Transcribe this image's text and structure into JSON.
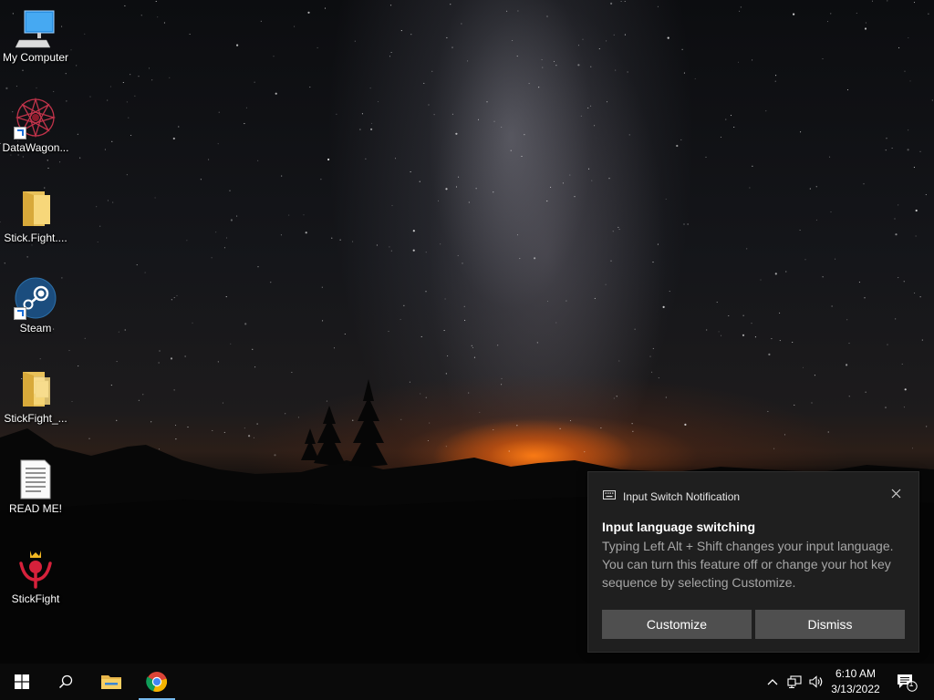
{
  "desktop": {
    "icons": [
      {
        "label": "My Computer",
        "icon": "computer-icon"
      },
      {
        "label": "DataWagon...",
        "icon": "datawagon-icon"
      },
      {
        "label": "Stick.Fight....",
        "icon": "folder-icon"
      },
      {
        "label": "Steam",
        "icon": "steam-icon"
      },
      {
        "label": "StickFight_...",
        "icon": "folder-icon"
      },
      {
        "label": "READ ME!",
        "icon": "text-document-icon"
      },
      {
        "label": "StickFight",
        "icon": "stickfight-icon"
      }
    ]
  },
  "notification": {
    "app_name": "Input Switch Notification",
    "app_icon": "keyboard-icon",
    "title": "Input language switching",
    "body": "Typing Left Alt + Shift changes your input language. You can turn this feature off or change your hot key sequence by selecting Customize.",
    "buttons": {
      "customize": "Customize",
      "dismiss": "Dismiss"
    },
    "close_icon": "close-icon"
  },
  "taskbar": {
    "start_icon": "windows-start-icon",
    "search_icon": "search-icon",
    "pinned": [
      {
        "name": "File Explorer",
        "icon": "file-explorer-icon",
        "active": false
      },
      {
        "name": "Google Chrome",
        "icon": "chrome-icon",
        "active": true
      }
    ],
    "tray": {
      "icons": [
        "chevron-up-icon",
        "network-icon",
        "volume-icon"
      ],
      "time": "6:10 AM",
      "date": "3/13/2022",
      "action_center_badge": "1"
    }
  },
  "colors": {
    "taskbar_bg": "#0a0a0a",
    "toast_bg": "#1f1f1f",
    "toast_button_bg": "#4f4f4f",
    "active_indicator": "#76b9ed"
  }
}
